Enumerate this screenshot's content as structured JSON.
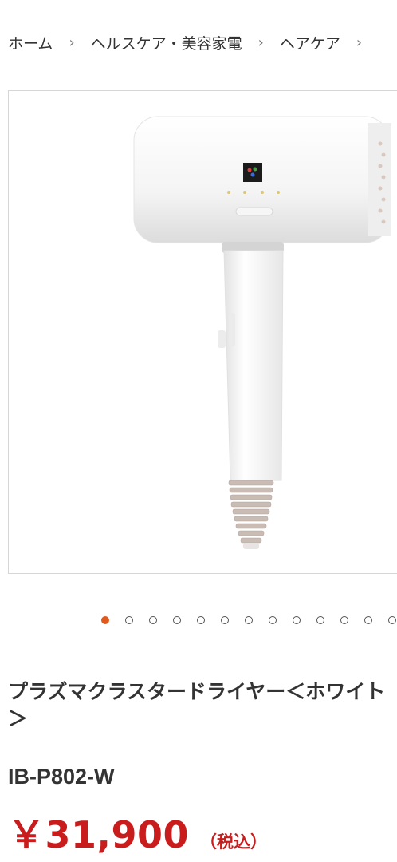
{
  "breadcrumb": {
    "items": [
      "ホーム",
      "ヘルスケア・美容家電",
      "ヘアケア"
    ],
    "separator": "›"
  },
  "gallery": {
    "image_icon": "hair-dryer-product-image",
    "dots_count": 13,
    "active_dot": 0,
    "accent": "#e05a1e"
  },
  "product": {
    "title_line1": "プラズマクラスタードライヤー＜ホワイト",
    "title_line2": "＞",
    "model": "IB-P802-W",
    "price": "￥31,900",
    "tax_label": "（税込）",
    "price_color": "#c91d1d"
  }
}
